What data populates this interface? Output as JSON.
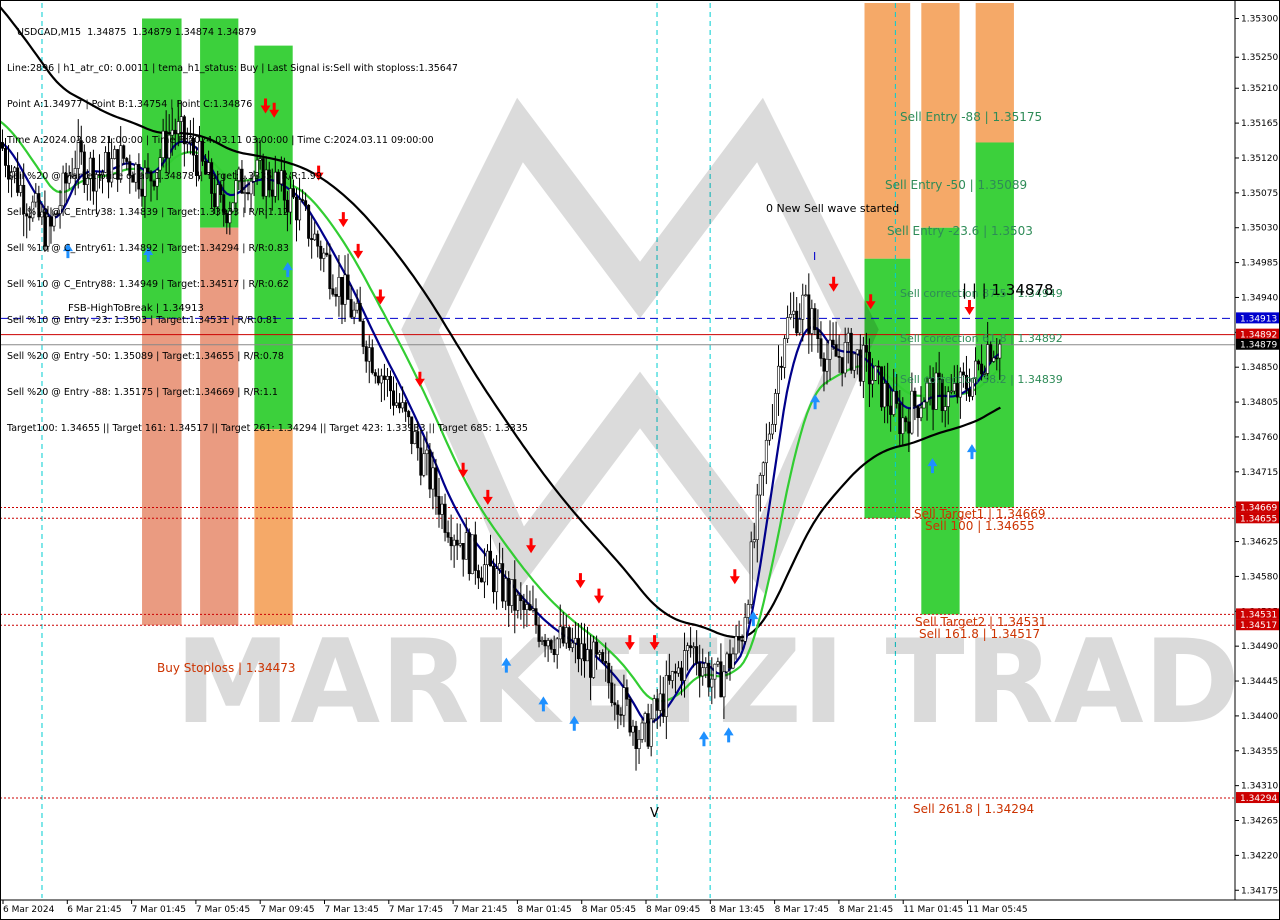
{
  "header": {
    "symbol_line": "USDCAD,M15  1.34875  1.34879 1.34874 1.34879",
    "lines": [
      "Line:2896 | h1_atr_c0: 0.0011 | tema_h1_status: Buy | Last Signal is:Sell with stoploss:1.35647",
      "Point A:1.34977 | Point B:1.34754 | Point C:1.34876",
      "Time A:2024.03.08 21:00:00 | Time B:2024.03.11 03:00:00 | Time C:2024.03.11 09:00:00",
      "Sell %20 @ Market price or at: 1.34878 || Target:1.3335 | R/R:1.99",
      "Sell %10 @ C_Entry38: 1.34839 | Target:1.33933 | R/R:1.12",
      "Sell %10 @ C_Entry61: 1.34892 | Target:1.34294 | R/R:0.83",
      "Sell %10 @ C_Entry88: 1.34949 | Target:1.34517 | R/R:0.62",
      "Sell %10 @ Entry -23: 1.3503 | Target:1.34531 | R/R:0.81",
      "Sell %20 @ Entry -50: 1.35089 | Target:1.34655 | R/R:0.78",
      "Sell %20 @ Entry -88: 1.35175 | Target:1.34669 | R/R:1.1",
      "Target100: 1.34655 || Target 161: 1.34517 || Target 261: 1.34294 || Target 423: 1.33933 || Target 685: 1.3335"
    ]
  },
  "labels": {
    "new_wave": "0 New Sell wave started",
    "sell_entry_88": "Sell Entry -88 | 1.35175",
    "sell_entry_50": "Sell Entry -50 | 1.35089",
    "sell_entry_23": "Sell Entry -23.6 | 1.3503",
    "sell_corr_875": "Sell correction 87.5 | 1.34949",
    "big_price": "| | | 1.34878",
    "sell_corr_618": "Sell correction 61.8 | 1.34892",
    "sell_corr_382": "Sell correction 38.2 | 1.34839",
    "fsb": "FSB-HighToBreak | 1.34913",
    "sell_target1": "Sell Target1 | 1.34669",
    "sell_100": "Sell 100 | 1.34655",
    "sell_target2": "Sell Target2 | 1.34531",
    "sell_1618": "Sell 161.8 | 1.34517",
    "sell_2618": "Sell 261.8 | 1.34294",
    "buy_stoploss": "Buy Stoploss | 1.34473",
    "wave_iv": "V",
    "wave_i": "I",
    "watermark": "MARKETZI TRADE"
  },
  "colors": {
    "background": "#ffffff",
    "green_zone": "#32cd32",
    "orange_zone": "#e9967a",
    "sand_zone": "#f4a460",
    "ema_blue": "#00008b",
    "ema_green": "#32cd32",
    "ema_black": "#000000",
    "dashed_blue": "#0000cd",
    "red_line": "#cc0000",
    "vline_cyan": "#00ced1",
    "candle": "#000000",
    "sell_arrow": "#ff0000",
    "buy_arrow": "#1e90ff"
  },
  "chart_data": {
    "type": "candlestick",
    "title": "USDCAD,M15",
    "ylim": [
      1.34165,
      1.3532
    ],
    "price_ticks": [
      "1.35300",
      "1.35250",
      "1.35210",
      "1.35165",
      "1.35120",
      "1.35075",
      "1.35030",
      "1.34985",
      "1.34940",
      "1.34895",
      "1.34850",
      "1.34805",
      "1.34760",
      "1.34715",
      "1.34670",
      "1.34625",
      "1.34580",
      "1.34535",
      "1.34490",
      "1.34445",
      "1.34400",
      "1.34355",
      "1.34310",
      "1.34265",
      "1.34220",
      "1.34175"
    ],
    "time_ticks": [
      "6 Mar 2024",
      "6 Mar 21:45",
      "7 Mar 01:45",
      "7 Mar 05:45",
      "7 Mar 09:45",
      "7 Mar 13:45",
      "7 Mar 17:45",
      "7 Mar 21:45",
      "8 Mar 01:45",
      "8 Mar 05:45",
      "8 Mar 09:45",
      "8 Mar 13:45",
      "8 Mar 17:45",
      "8 Mar 21:45",
      "11 Mar 01:45",
      "11 Mar 05:45"
    ],
    "price_tags": [
      {
        "value": "1.34913",
        "color": "#0000cd"
      },
      {
        "value": "1.34892",
        "color": "#cc0000"
      },
      {
        "value": "1.34879",
        "color": "#000000"
      },
      {
        "value": "1.34669",
        "color": "#cc0000"
      },
      {
        "value": "1.34655",
        "color": "#cc0000"
      },
      {
        "value": "1.34531",
        "color": "#cc0000"
      },
      {
        "value": "1.34517",
        "color": "#cc0000"
      },
      {
        "value": "1.34294",
        "color": "#cc0000"
      }
    ],
    "levels": {
      "fsb_high": 1.34913,
      "sell_corr_618": 1.34892,
      "last_price": 1.34879,
      "sell_target1": 1.34669,
      "sell_100": 1.34655,
      "sell_target2": 1.34531,
      "sell_1618": 1.34517,
      "sell_2618": 1.34294
    },
    "price_path": [
      [
        0,
        1.3514
      ],
      [
        0.02,
        1.3507
      ],
      [
        0.04,
        1.3502
      ],
      [
        0.06,
        1.3512
      ],
      [
        0.08,
        1.351
      ],
      [
        0.1,
        1.3512
      ],
      [
        0.12,
        1.3509
      ],
      [
        0.14,
        1.3516
      ],
      [
        0.16,
        1.3512
      ],
      [
        0.18,
        1.3505
      ],
      [
        0.2,
        1.351
      ],
      [
        0.22,
        1.3509
      ],
      [
        0.24,
        1.3506
      ],
      [
        0.26,
        1.35
      ],
      [
        0.28,
        1.3494
      ],
      [
        0.3,
        1.3487
      ],
      [
        0.32,
        1.3481
      ],
      [
        0.34,
        1.3474
      ],
      [
        0.36,
        1.3466
      ],
      [
        0.38,
        1.3461
      ],
      [
        0.4,
        1.3458
      ],
      [
        0.42,
        1.3454
      ],
      [
        0.44,
        1.3451
      ],
      [
        0.46,
        1.3449
      ],
      [
        0.48,
        1.3447
      ],
      [
        0.5,
        1.3443
      ],
      [
        0.52,
        1.3437
      ],
      [
        0.54,
        1.3443
      ],
      [
        0.56,
        1.3449
      ],
      [
        0.58,
        1.3444
      ],
      [
        0.6,
        1.345
      ],
      [
        0.62,
        1.3474
      ],
      [
        0.635,
        1.349
      ],
      [
        0.65,
        1.3493
      ],
      [
        0.66,
        1.349
      ],
      [
        0.67,
        1.3486
      ],
      [
        0.69,
        1.3487
      ],
      [
        0.71,
        1.3483
      ],
      [
        0.73,
        1.3478
      ],
      [
        0.75,
        1.3482
      ],
      [
        0.77,
        1.3481
      ],
      [
        0.79,
        1.3484
      ],
      [
        0.8,
        1.34879
      ]
    ],
    "zones": [
      {
        "x": [
          0.115,
          0.147
        ],
        "y": [
          1.353,
          1.34913
        ],
        "color": "green"
      },
      {
        "x": [
          0.115,
          0.147
        ],
        "y": [
          1.34913,
          1.34517
        ],
        "color": "orange"
      },
      {
        "x": [
          0.162,
          0.193
        ],
        "y": [
          1.353,
          1.3503
        ],
        "color": "green"
      },
      {
        "x": [
          0.162,
          0.193
        ],
        "y": [
          1.3503,
          1.34517
        ],
        "color": "orange"
      },
      {
        "x": [
          0.206,
          0.237
        ],
        "y": [
          1.35265,
          1.3477
        ],
        "color": "green"
      },
      {
        "x": [
          0.206,
          0.237
        ],
        "y": [
          1.3477,
          1.34517
        ],
        "color": "sand"
      },
      {
        "x": [
          0.7,
          0.737
        ],
        "y": [
          1.3532,
          1.3499
        ],
        "color": "sand"
      },
      {
        "x": [
          0.7,
          0.737
        ],
        "y": [
          1.3499,
          1.34655
        ],
        "color": "green"
      },
      {
        "x": [
          0.746,
          0.777
        ],
        "y": [
          1.3532,
          1.3503
        ],
        "color": "sand"
      },
      {
        "x": [
          0.746,
          0.777
        ],
        "y": [
          1.3503,
          1.34531
        ],
        "color": "green"
      },
      {
        "x": [
          0.79,
          0.821
        ],
        "y": [
          1.3532,
          1.3514
        ],
        "color": "sand"
      },
      {
        "x": [
          0.79,
          0.821
        ],
        "y": [
          1.3514,
          1.34669
        ],
        "color": "green"
      }
    ]
  }
}
